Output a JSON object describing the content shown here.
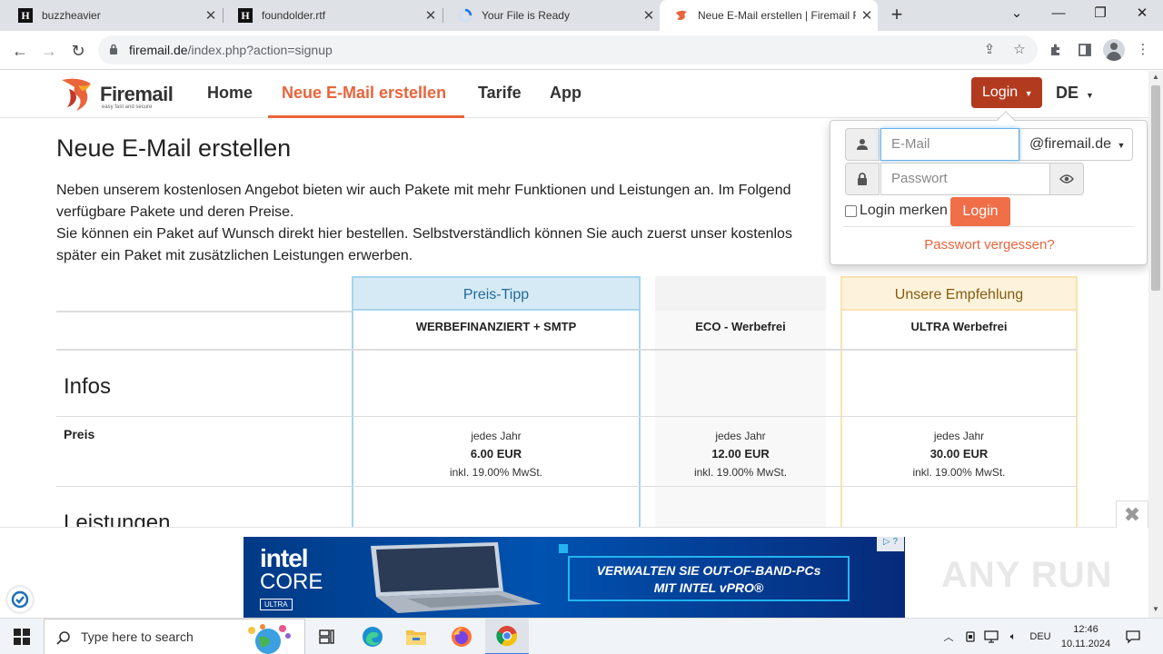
{
  "browser": {
    "tabs": [
      {
        "title": "buzzheavier",
        "icon": "h-favicon"
      },
      {
        "title": "foundolder.rtf",
        "icon": "h-favicon"
      },
      {
        "title": "Your File is Ready",
        "icon": "loading-spinner"
      },
      {
        "title": "Neue E-Mail erstellen | Firemail F",
        "icon": "firemail-favicon",
        "active": true
      }
    ],
    "url_host": "firemail.de",
    "url_path": "/index.php?action=signup"
  },
  "site": {
    "logo_word": "Firemail",
    "logo_tagline": "easy fast and secure",
    "nav": [
      {
        "label": "Home"
      },
      {
        "label": "Neue E-Mail erstellen",
        "active": true
      },
      {
        "label": "Tarife"
      },
      {
        "label": "App"
      }
    ],
    "login_button": "Login",
    "language": "DE"
  },
  "page": {
    "title": "Neue E-Mail erstellen",
    "intro_lines": [
      "Neben unserem kostenlosen Angebot bieten wir auch Pakete mit mehr Funktionen und Leistungen an. Im Folgend",
      "verfügbare Pakete und deren Preise.",
      "Sie können ein Paket auf Wunsch direkt hier bestellen. Selbstverständlich können Sie auch zuerst unser kostenlos",
      "später ein Paket mit zusätzlichen Leistungen erwerben."
    ]
  },
  "table": {
    "column_badges": [
      "Preis-Tipp",
      "",
      "Unsere Empfehlung"
    ],
    "packages": [
      "WERBEFINANZIERT + SMTP",
      "ECO - Werbefrei",
      "ULTRA Werbefrei"
    ],
    "section_infos": "Infos",
    "row_price": "Preis",
    "prices": [
      {
        "period": "jedes Jahr",
        "amount": "6.00 EUR",
        "vat": "inkl. 19.00% MwSt."
      },
      {
        "period": "jedes Jahr",
        "amount": "12.00 EUR",
        "vat": "inkl. 19.00% MwSt."
      },
      {
        "period": "jedes Jahr",
        "amount": "30.00 EUR",
        "vat": "inkl. 19.00% MwSt."
      }
    ],
    "section_leistungen": "Leistungen"
  },
  "login_popover": {
    "email_placeholder": "E-Mail",
    "domain": "@firemail.de",
    "password_placeholder": "Passwort",
    "remember_label": "Login merken",
    "remember_checked": false,
    "submit_label": "Login",
    "forgot_link": "Passwort vergessen?"
  },
  "ad": {
    "brand": "intel",
    "product": "CORE",
    "badge": "ULTRA",
    "headline_lines": [
      "VERWALTEN SIE OUT-OF-BAND-PCs",
      "MIT INTEL vPRO®"
    ]
  },
  "watermark": "ANY RUN",
  "taskbar": {
    "search_placeholder": "Type here to search",
    "language": "DEU",
    "time": "12:46",
    "date": "10.11.2024"
  },
  "colors": {
    "brand_orange": "#e9643b",
    "login_dark": "#b23a1f",
    "preis_tipp_bg": "#d6eaf6",
    "empfehlung_bg": "#fdf3dd"
  }
}
